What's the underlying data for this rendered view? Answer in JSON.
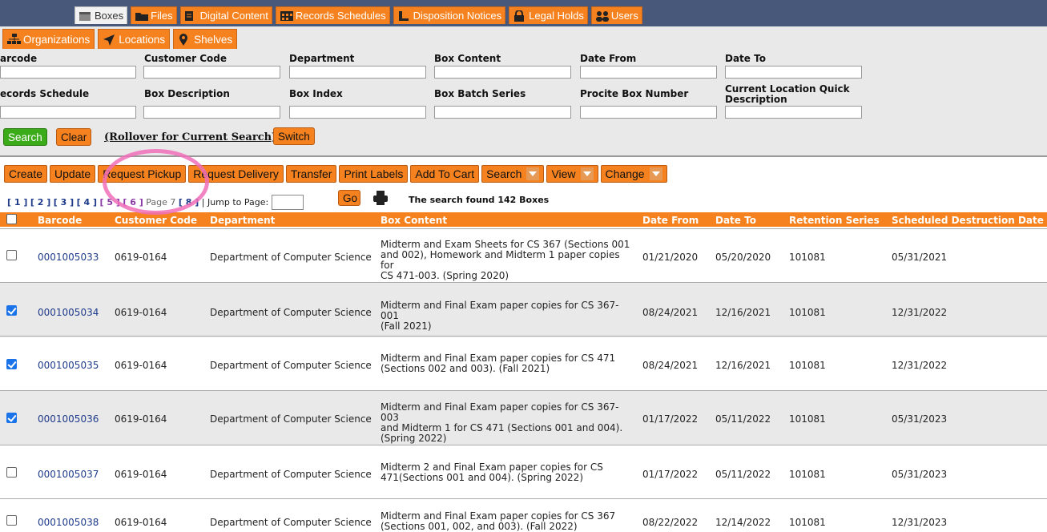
{
  "top_tabs": [
    {
      "label": "Boxes",
      "icon": "box-icon",
      "active": true
    },
    {
      "label": "Files",
      "icon": "folder-icon"
    },
    {
      "label": "Digital Content",
      "icon": "document-icon"
    },
    {
      "label": "Records Schedules",
      "icon": "calendar-icon"
    },
    {
      "label": "Disposition Notices",
      "icon": "notice-icon"
    },
    {
      "label": "Legal Holds",
      "icon": "lock-icon"
    },
    {
      "label": "Users",
      "icon": "users-icon"
    }
  ],
  "sub_tabs": [
    {
      "label": "Organizations",
      "icon": "org-chart-icon"
    },
    {
      "label": "Locations",
      "icon": "location-arrow-icon"
    },
    {
      "label": "Shelves",
      "icon": "map-pin-icon"
    }
  ],
  "search_fields": {
    "barcode": "arcode",
    "customer_code": "Customer Code",
    "department": "Department",
    "box_content": "Box Content",
    "date_from": "Date From",
    "date_to": "Date To",
    "records_schedule": "ecords Schedule",
    "box_description": "Box Description",
    "box_index": "Box Index",
    "box_batch_series": "Box Batch Series",
    "procite_box_number": "Procite Box Number",
    "current_location_line1": "Current Location Quick",
    "current_location_line2": "Description"
  },
  "search_buttons": {
    "search": "Search",
    "clear": "Clear",
    "rollover": "(Rollover for Current Search)",
    "switch": "Switch"
  },
  "actions": [
    {
      "label": "Create"
    },
    {
      "label": "Update"
    },
    {
      "label": "Request Pickup"
    },
    {
      "label": "Request Delivery"
    },
    {
      "label": "Transfer"
    },
    {
      "label": "Print Labels"
    },
    {
      "label": "Add To Cart"
    },
    {
      "label": "Search",
      "dropdown": true
    },
    {
      "label": "View",
      "dropdown": true
    },
    {
      "label": "Change",
      "dropdown": true
    }
  ],
  "pager": {
    "p1": "[ 1 ]",
    "p2": "[ 2 ]",
    "p3": "[ 3 ]",
    "p4": "[ 4 ]",
    "p5": "[ 5 ]",
    "p6": "[ 6 ]",
    "current": "Page 7",
    "p8": "[ 8 ]",
    "jump_label": "| Jump to Page:",
    "go": "Go"
  },
  "found": "The search found  142 Boxes",
  "columns": {
    "barcode": "Barcode",
    "customer_code": "Customer Code",
    "department": "Department",
    "box_content": "Box Content",
    "date_from": "Date From",
    "date_to": "Date To",
    "retention_series": "Retention Series",
    "destruction": "Scheduled Destruction Date"
  },
  "rows": [
    {
      "checked": false,
      "barcode": "0001005033",
      "customer_code": "0619-0164",
      "department": "Department of Computer Science",
      "content": [
        "Midterm and Exam Sheets for CS 367 (Sections 001",
        "and 002), Homework and Midterm 1 paper copies for",
        "CS 471-003. (Spring 2020)"
      ],
      "date_from": "01/21/2020",
      "date_to": "05/20/2020",
      "retention": "101081",
      "destruction": "05/31/2021"
    },
    {
      "checked": true,
      "barcode": "0001005034",
      "customer_code": "0619-0164",
      "department": "Department of Computer Science",
      "content": [
        "Midterm and Final Exam paper copies for CS 367-001",
        "(Fall 2021)"
      ],
      "date_from": "08/24/2021",
      "date_to": "12/16/2021",
      "retention": "101081",
      "destruction": "12/31/2022"
    },
    {
      "checked": true,
      "barcode": "0001005035",
      "customer_code": "0619-0164",
      "department": "Department of Computer Science",
      "content": [
        "Midterm and Final Exam paper copies for CS 471",
        "(Sections 002 and 003). (Fall 2021)"
      ],
      "date_from": "08/24/2021",
      "date_to": "12/16/2021",
      "retention": "101081",
      "destruction": "12/31/2022"
    },
    {
      "checked": true,
      "barcode": "0001005036",
      "customer_code": "0619-0164",
      "department": "Department of Computer Science",
      "content": [
        "Midterm and Final Exam paper copies for CS 367-003",
        "and Midterm 1 for CS 471 (Sections 001 and 004).",
        "(Spring 2022)"
      ],
      "date_from": "01/17/2022",
      "date_to": "05/11/2022",
      "retention": "101081",
      "destruction": "05/31/2023"
    },
    {
      "checked": false,
      "barcode": "0001005037",
      "customer_code": "0619-0164",
      "department": "Department of Computer Science",
      "content": [
        "Midterm 2 and Final Exam paper copies for CS",
        "471(Sections 001 and 004). (Spring 2022)"
      ],
      "date_from": "01/17/2022",
      "date_to": "05/11/2022",
      "retention": "101081",
      "destruction": "05/31/2023"
    },
    {
      "checked": false,
      "barcode": "0001005038",
      "customer_code": "0619-0164",
      "department": "Department of Computer Science",
      "content": [
        "Midterm and Final Exam paper copies for CS 367",
        "(Sections 001, 002, and 003). (Fall 2022)"
      ],
      "date_from": "08/22/2022",
      "date_to": "12/14/2022",
      "retention": "101081",
      "destruction": "12/31/2023"
    }
  ]
}
